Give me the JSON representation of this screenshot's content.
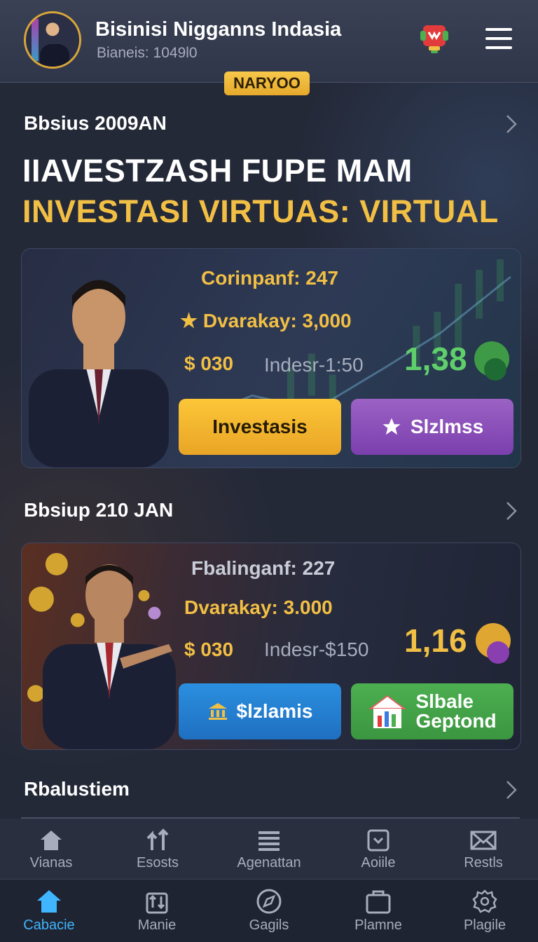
{
  "header": {
    "title": "Bisinisi Nigganns Indasia",
    "subtitle": "Bianeis: 1049l0",
    "badge": "NARYOO"
  },
  "section1": {
    "label": "Bbsius 2009AN",
    "headline_1": "IIAVESTZASH FUPE MAM",
    "headline_2": "INVESTASI VIRTUAS: VIRTUAL"
  },
  "card1": {
    "company": "Corinpanf: 247",
    "dividend": "Dvarakay: 3,000",
    "price": "$ 030",
    "index": "Indesr-1:50",
    "value": "1,38",
    "primary_button": "Investasis",
    "secondary_button": "Slzlmss"
  },
  "section2": {
    "label": "Bbsiup 210 JAN"
  },
  "card2": {
    "company": "Fbalinganf: 227",
    "dividend": "Dvarakay: 3.000",
    "price": "$ 030",
    "index": "Indesr-$150",
    "value": "1,16",
    "primary_button": "$lzlamis",
    "secondary_button_line1": "Slbale",
    "secondary_button_line2": "Geptond"
  },
  "section3": {
    "label": "Rbalustiem"
  },
  "nav_top": [
    {
      "label": "Vianas",
      "icon": "home-icon"
    },
    {
      "label": "Esosts",
      "icon": "transfer-icon"
    },
    {
      "label": "Agenattan",
      "icon": "list-icon"
    },
    {
      "label": "Aoiile",
      "icon": "tag-icon"
    },
    {
      "label": "Restls",
      "icon": "mail-icon"
    }
  ],
  "nav_bottom": [
    {
      "label": "Cabacie",
      "icon": "home-icon",
      "active": true
    },
    {
      "label": "Manie",
      "icon": "trade-icon"
    },
    {
      "label": "Gagils",
      "icon": "compass-icon"
    },
    {
      "label": "Plamne",
      "icon": "bag-icon"
    },
    {
      "label": "Plagile",
      "icon": "gear-icon"
    }
  ],
  "colors": {
    "accent_gold": "#f2bf45",
    "accent_green": "#5fcf6b",
    "accent_blue": "#3fb6ff",
    "background": "#242938"
  }
}
